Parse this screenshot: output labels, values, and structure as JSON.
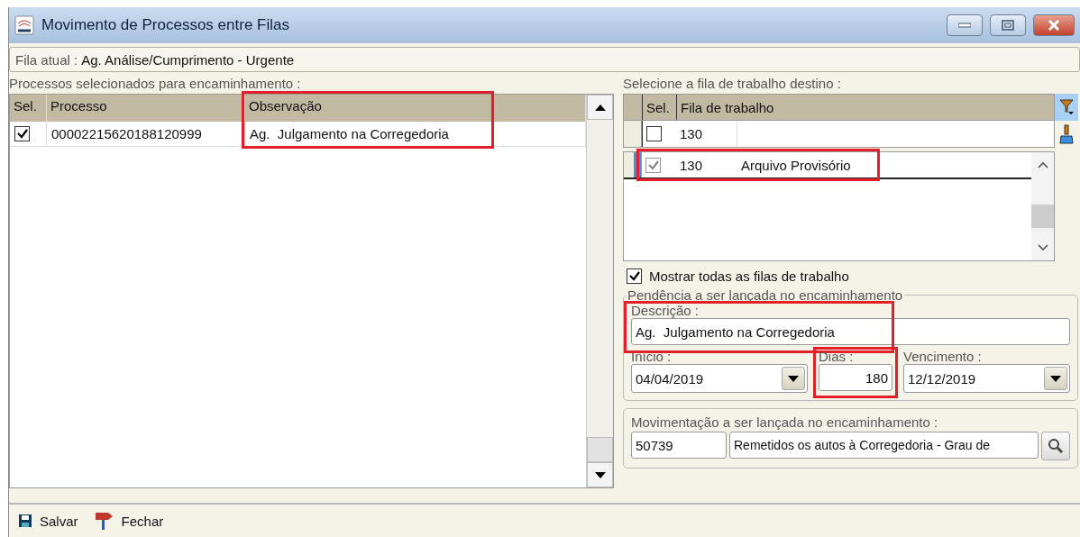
{
  "window": {
    "title": "Movimento de Processos entre Filas"
  },
  "current_queue": {
    "label": "Fila atual :",
    "value": "Ag. Análise/Cumprimento - Urgente"
  },
  "selected_processes": {
    "caption": "Processos selecionados para encaminhamento :",
    "columns": [
      {
        "label": "Sel.",
        "highlighted": false
      },
      {
        "label": "Processo",
        "highlighted": false
      },
      {
        "label": "Observação",
        "highlighted": true
      }
    ],
    "rows": [
      {
        "checked": true,
        "processo": "00002215620188120999",
        "observacao": "Ag.  Julgamento na Corregedoria"
      }
    ]
  },
  "destination": {
    "caption": "Selecione a fila de trabalho destino :",
    "columns": [
      "Sel.",
      "Fila de trabalho"
    ],
    "filter_row": {
      "checked": false,
      "code": "130"
    },
    "rows": [
      {
        "checked": true,
        "selected": true,
        "highlighted": true,
        "code": "130",
        "name": "Arquivo Provisório"
      }
    ]
  },
  "show_all": {
    "label": "Mostrar todas as filas de trabalho",
    "checked": true
  },
  "pendencia": {
    "legend": "Pendência a ser lançada no encaminhamento",
    "descricao": {
      "label": "Descrição :",
      "value": "Ag.  Julgamento na Corregedoria",
      "highlighted": true
    },
    "inicio": {
      "label": "Início :",
      "value": "04/04/2019"
    },
    "dias": {
      "label": "Dias :",
      "value": "180",
      "highlighted": true
    },
    "vencimento": {
      "label": "Vencimento :",
      "value": "12/12/2019"
    }
  },
  "movimentacao": {
    "legend": "Movimentação a ser lançada no encaminhamento :",
    "code": "50739",
    "description": "Remetidos os autos à Corregedoria - Grau de"
  },
  "actions": [
    {
      "label": "Salvar",
      "kind": "save"
    },
    {
      "label": "Fechar",
      "kind": "close"
    }
  ]
}
